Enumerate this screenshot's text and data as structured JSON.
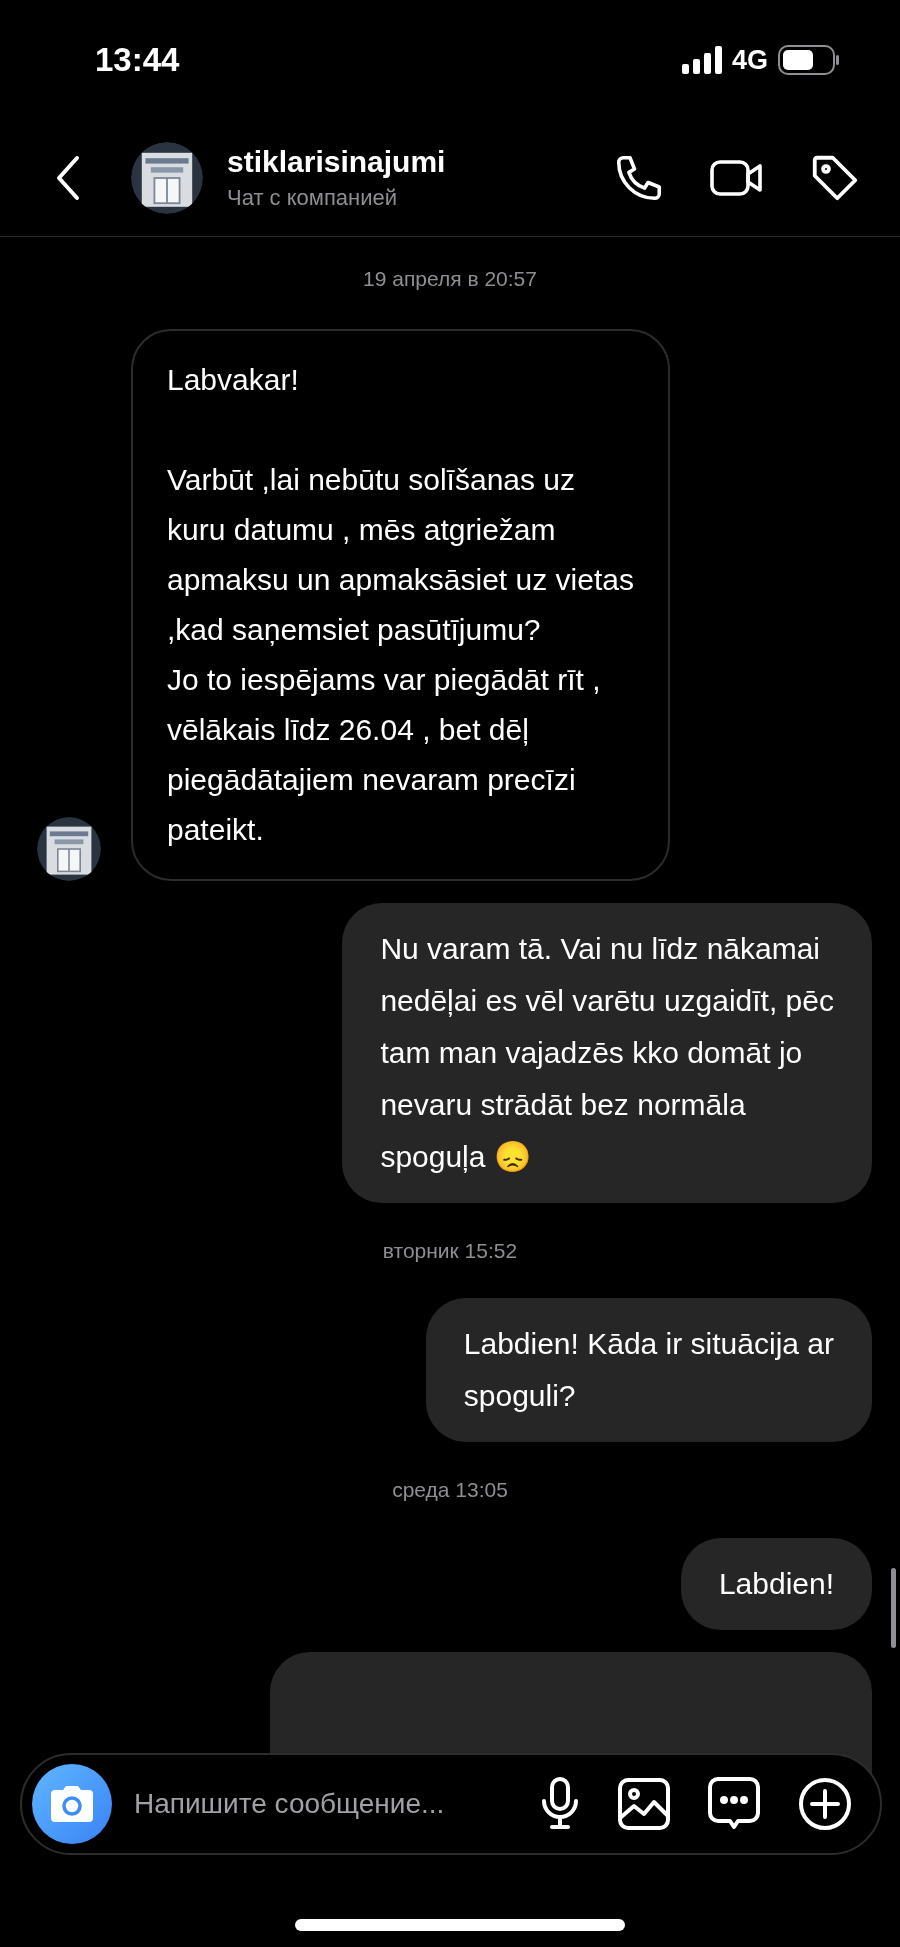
{
  "status_bar": {
    "time": "13:44",
    "network": "4G"
  },
  "header": {
    "name": "stiklarisinajumi",
    "subtitle": "Чат с компанией"
  },
  "messages": [
    {
      "kind": "date",
      "text": "19 апреля в 20:57"
    },
    {
      "kind": "incoming",
      "text": "Labvakar!\n\nVarbūt ,lai nebūtu solīšanas uz\nkuru datumu , mēs atgriežam\napmaksu un apmaksāsiet uz vietas\n,kad saņemsiet pasūtījumu?\nJo to iespējams var piegādāt rīt ,\nvēlākais līdz 26.04 , bet dēļ\npiegādātajiem nevaram precīzi\npateikt."
    },
    {
      "kind": "outgoing",
      "text": "Nu varam tā. Vai nu līdz nākamai\nnedēļai es vēl varētu uzgaidīt, pēc\ntam man vajadzēs kko domāt jo\nnevaru strādāt bez normāla\nspoguļa 😞"
    },
    {
      "kind": "date",
      "text": "вторник 15:52"
    },
    {
      "kind": "outgoing",
      "text": "Labdien! Kāda ir situācija ar\nspoguli?"
    },
    {
      "kind": "date",
      "text": "среда 13:05"
    },
    {
      "kind": "outgoing",
      "text": "Labdien!"
    }
  ],
  "composer": {
    "placeholder": "Напишите сообщение..."
  }
}
